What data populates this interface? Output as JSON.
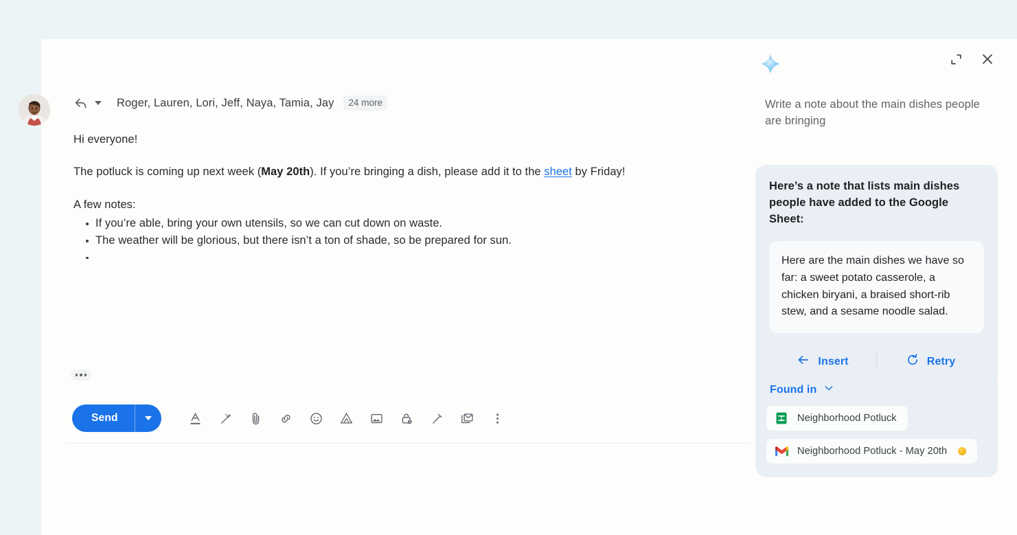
{
  "window": {
    "page_background": "#ecf4f6",
    "surface_background": "#fdfdfc",
    "accent_blue": "#1a73e8"
  },
  "compose": {
    "avatar_alt": "sender-avatar",
    "reply_mode_icon": "reply-arrow-icon",
    "recipients": "Roger, Lauren, Lori, Jeff, Naya, Tamia, Jay",
    "more_count": "24 more",
    "greeting": "Hi everyone!",
    "paragraph_1": {
      "before_bold": "The potluck is coming up next week (",
      "bold": "May 20th",
      "after_bold": "). If you’re bringing a dish, please add it to the ",
      "link": "sheet",
      "tail": " by Friday!"
    },
    "notes_heading": "A few notes:",
    "bullets": [
      "If you’re able, bring your own utensils, so we can cut down on waste.",
      "The weather will be glorious, but there isn’t a ton of shade, so be prepared for sun.",
      ""
    ],
    "trimmed_content_label": "…",
    "toolbar": {
      "send_label": "Send",
      "send_more_icon": "caret-down-icon",
      "icons": [
        "format-text-icon",
        "magic-wand-icon",
        "attach-file-icon",
        "insert-link-icon",
        "insert-emoji-icon",
        "insert-drive-icon",
        "insert-photo-icon",
        "confidential-mode-icon",
        "signature-pen-icon",
        "mail-template-icon",
        "more-options-icon"
      ]
    }
  },
  "panel": {
    "brand_icon": "gemini-sparkle-icon",
    "expand_icon": "expand-icon",
    "close_icon": "close-icon",
    "prompt": "Write a note about the main dishes people are bringing",
    "result": {
      "intro": "Here’s a note that lists main dishes people have added to the Google Sheet:",
      "note": "Here are the main dishes we have so far: a sweet potato casserole, a chicken biryani, a braised short-rib stew, and a sesame noodle salad.",
      "insert_label": "Insert",
      "insert_icon": "arrow-left-icon",
      "retry_label": "Retry",
      "retry_icon": "refresh-icon",
      "card_background": "#eaeff5",
      "note_background": "#f9fafb"
    },
    "found_in": {
      "label": "Found in",
      "chevron_icon": "chevron-down-icon",
      "items": [
        {
          "icon": "google-sheets-icon",
          "title": "Neighborhood Potluck",
          "emoji": ""
        },
        {
          "icon": "gmail-icon",
          "title": "Neighborhood Potluck - May 20th",
          "emoji": "sun-emoji"
        }
      ]
    }
  }
}
